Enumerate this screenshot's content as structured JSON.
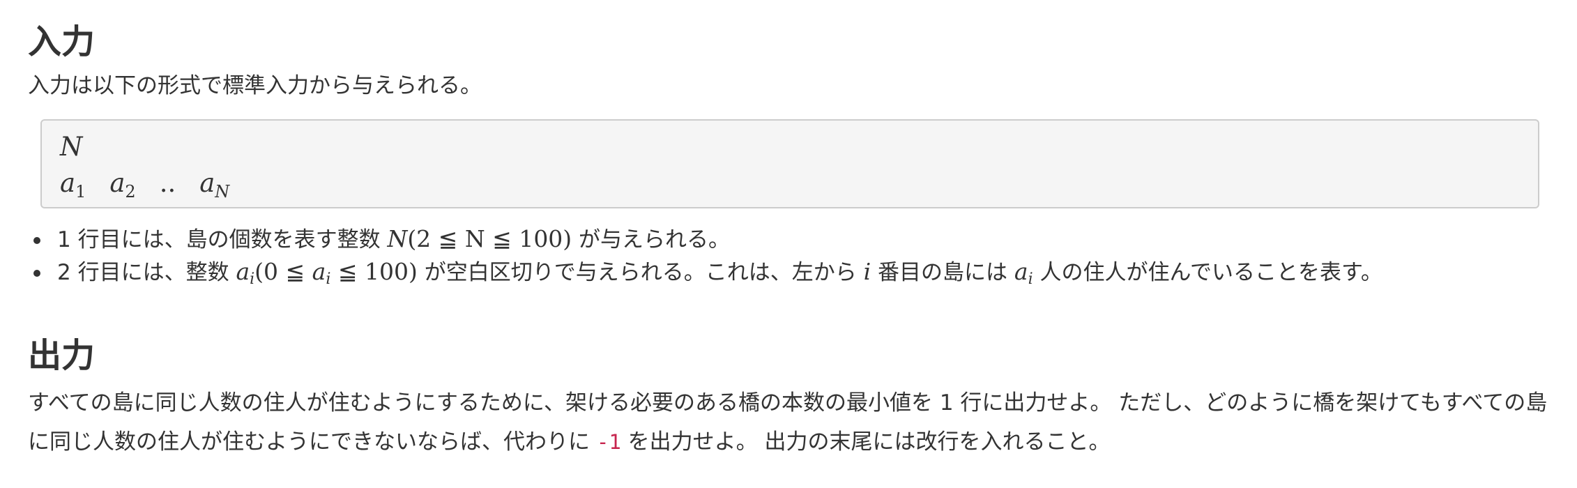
{
  "input_section": {
    "heading": "入力",
    "intro": "入力は以下の形式で標準入力から与えられる。",
    "format": {
      "line1": "N",
      "line2": [
        "a",
        "1",
        "a",
        "2",
        "..",
        "a",
        "N"
      ]
    },
    "constraints": [
      {
        "pre": "1 行目には、島の個数を表す整数 ",
        "math": "N",
        "range": "(2 ≦ N ≦ 100)",
        "post": " が与えられる。"
      },
      {
        "pre": "2 行目には、整数 ",
        "math": "a",
        "sub": "i",
        "range_open": "(0 ≦ ",
        "range_var": "a",
        "range_sub": "i",
        "range_close": " ≦ 100)",
        "mid": " が空白区切りで与えられる。これは、左から ",
        "var_i": "i",
        "mid2": " 番目の島には ",
        "var_a": "a",
        "var_a_sub": "i",
        "post": " 人の住人が住んでいることを表す。"
      }
    ]
  },
  "output_section": {
    "heading": "出力",
    "text_before_code": "すべての島に同じ人数の住人が住むようにするために、架ける必要のある橋の本数の最小値を 1 行に出力せよ。 ただし、どのように橋を架けてもすべての島に同じ人数の住人が住むようにできないならば、代わりに ",
    "code": "-1",
    "text_after_code": " を出力せよ。 出力の末尾には改行を入れること。"
  }
}
